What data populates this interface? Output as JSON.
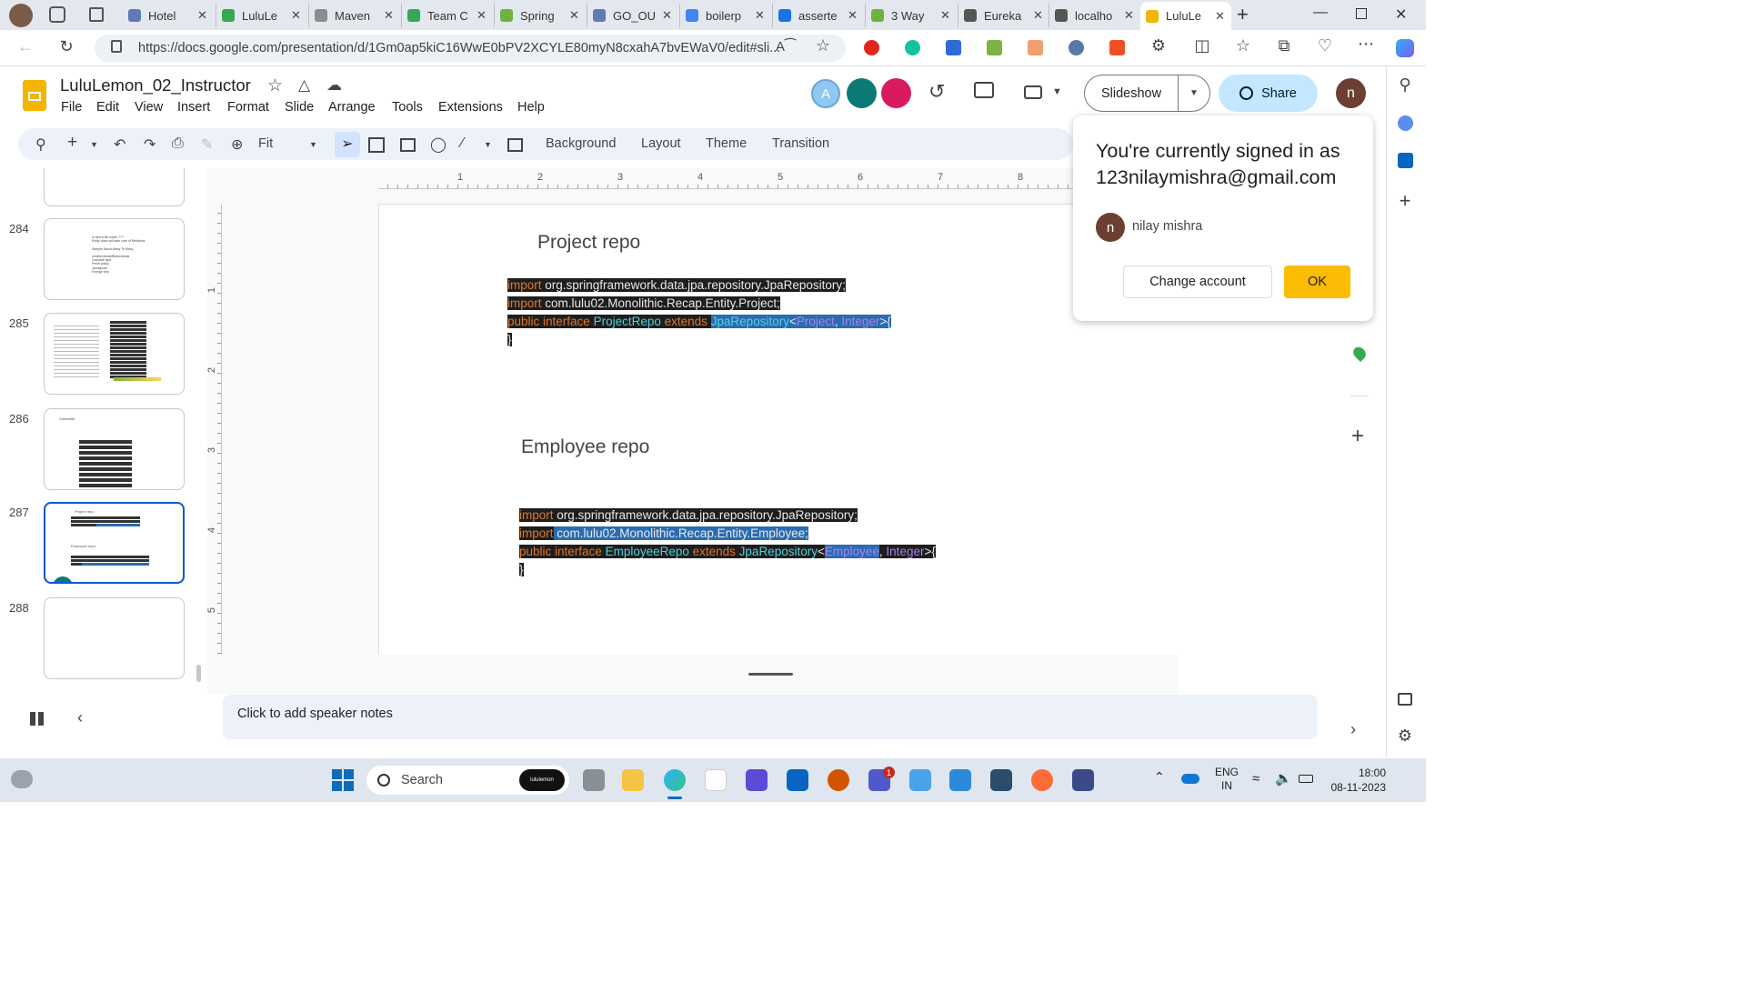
{
  "tabs": [
    {
      "title": "Hotel",
      "color": "#5f7bb5"
    },
    {
      "title": "LuluLe",
      "color": "#34a853"
    },
    {
      "title": "Maven",
      "color": "#8c8c8c"
    },
    {
      "title": "Team C",
      "color": "#34a853"
    },
    {
      "title": "Spring",
      "color": "#6db33f"
    },
    {
      "title": "GO_OU",
      "color": "#5f7bb5"
    },
    {
      "title": "boilerp",
      "color": "#4285f4"
    },
    {
      "title": "asserte",
      "color": "#1a73e8"
    },
    {
      "title": "3 Way",
      "color": "#6db33f"
    },
    {
      "title": "Eureka",
      "color": "#555555"
    },
    {
      "title": "localho",
      "color": "#555555"
    },
    {
      "title": "LuluLe",
      "color": "#f4b400"
    }
  ],
  "browser": {
    "url": "https://docs.google.com/presentation/d/1Gm0ap5kiC16WwE0bPV2XCYLE80myN8cxahA7bvEWaV0/edit#sli..."
  },
  "doc": {
    "title": "LuluLemon_02_Instructor",
    "menus": [
      "File",
      "Edit",
      "View",
      "Insert",
      "Format",
      "Slide",
      "Arrange",
      "Tools",
      "Extensions",
      "Help"
    ],
    "avatar_a": "A",
    "user_initial": "n",
    "slideshow_label": "Slideshow",
    "share_label": "Share"
  },
  "toolbar": {
    "zoom": "Fit",
    "background": "Background",
    "layout": "Layout",
    "theme": "Theme",
    "transition": "Transition"
  },
  "ruler": {
    "h": [
      "1",
      "2",
      "3",
      "4",
      "5",
      "6",
      "7",
      "8"
    ],
    "v": [
      "1",
      "2",
      "3",
      "4",
      "5"
    ]
  },
  "slides": [
    {
      "num": "284",
      "lines": [
        "In which file which ???",
        "Entity class will take care of Relations",
        "",
        "Sample About Many To Many",
        "",
        "Unidirectional/Bidirectional",
        "Cascade type",
        "Fetch policy",
        "Jsonignore",
        "Foreign Key"
      ]
    },
    {
      "num": "285"
    },
    {
      "num": "286",
      "label": "Controller"
    },
    {
      "num": "287",
      "labels": [
        "Project repo",
        "Employee repo"
      ]
    },
    {
      "num": "288"
    }
  ],
  "slide": {
    "heading1": "Project repo",
    "code1": {
      "l1_kw": "import",
      "l1_rest": " org.springframework.data.jpa.repository.JpaRepository;",
      "l2_kw": "import",
      "l2_rest": " com.lulu02.Monolithic.Recap.Entity.Project;",
      "l3_kw": "public interface ",
      "l3_name": "ProjectRepo",
      "l3_ext": " extends ",
      "l3_jpa": "JpaRepository",
      "l3_lt": "<",
      "l3_t1": "Project",
      "l3_c": ", ",
      "l3_t2": "Integer",
      "l3_gt": ">{",
      "l4": "}"
    },
    "heading2": "Employee repo",
    "code2": {
      "l1_kw": "import",
      "l1_rest": " org.springframework.data.jpa.repository.JpaRepository;",
      "l2_kw": "import",
      "l2_rest": " com.lulu02.Monolithic.Recap.Entity.Employee;",
      "l3_kw": "public interface ",
      "l3_name": "EmployeeRepo",
      "l3_ext": " extends ",
      "l3_jpa": "JpaRepository",
      "l3_lt": "<",
      "l3_t1": "Employee",
      "l3_c": ", ",
      "l3_t2": "Integer",
      "l3_gt": ">{",
      "l4": "}"
    }
  },
  "notes": {
    "placeholder": "Click to add speaker notes"
  },
  "popup": {
    "heading": "You're currently signed in as",
    "email": "123nilaymishra@gmail.com",
    "name": "nilay mishra",
    "initial": "n",
    "change": "Change account",
    "ok": "OK"
  },
  "taskbar": {
    "search": "Search",
    "search_badge": "lululemon",
    "lang1": "ENG",
    "lang2": "IN",
    "time": "18:00",
    "date": "08-11-2023",
    "teams_badge": "1"
  }
}
